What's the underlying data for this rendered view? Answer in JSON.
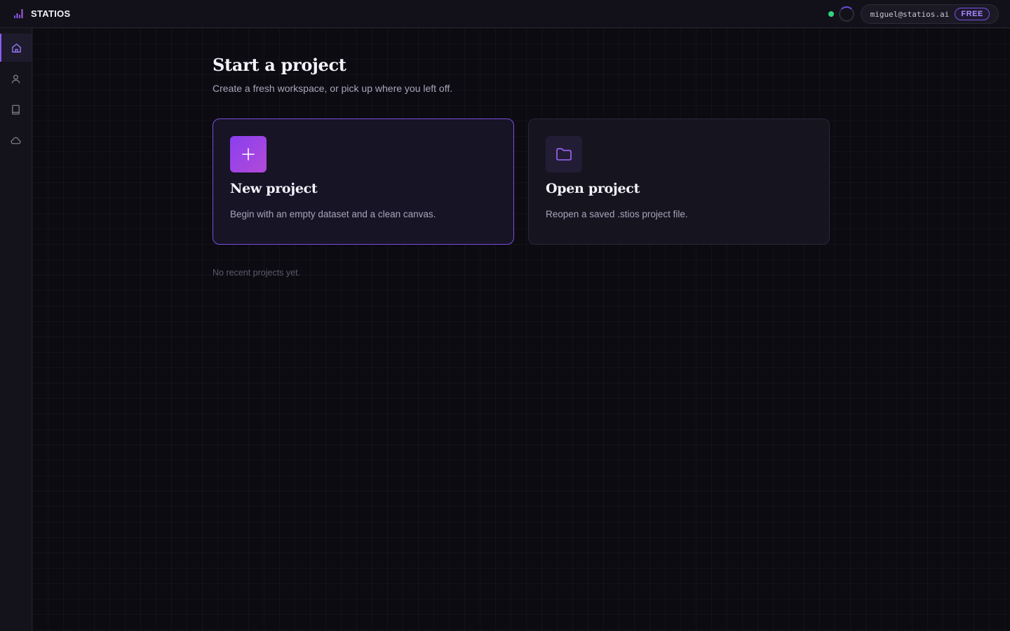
{
  "app": {
    "name": "STATIOS"
  },
  "account": {
    "email": "miguel@statios.ai",
    "plan": "FREE"
  },
  "sidebar": {
    "items": [
      {
        "icon": "home-icon",
        "active": true
      },
      {
        "icon": "user-icon",
        "active": false
      },
      {
        "icon": "book-icon",
        "active": false
      },
      {
        "icon": "cloud-icon",
        "active": false
      }
    ]
  },
  "main": {
    "title": "Start a project",
    "subtitle": "Create a fresh workspace, or pick up where you left off.",
    "cards": [
      {
        "icon": "plus-icon",
        "title": "New project",
        "description": "Begin with an empty dataset and a clean canvas."
      },
      {
        "icon": "folder-icon",
        "title": "Open project",
        "description": "Reopen a saved .stios project file."
      }
    ],
    "recent_empty": "No recent projects yet."
  },
  "colors": {
    "accent": "#8b5cf6",
    "status_online": "#2fd47b",
    "background": "#0c0b11"
  }
}
